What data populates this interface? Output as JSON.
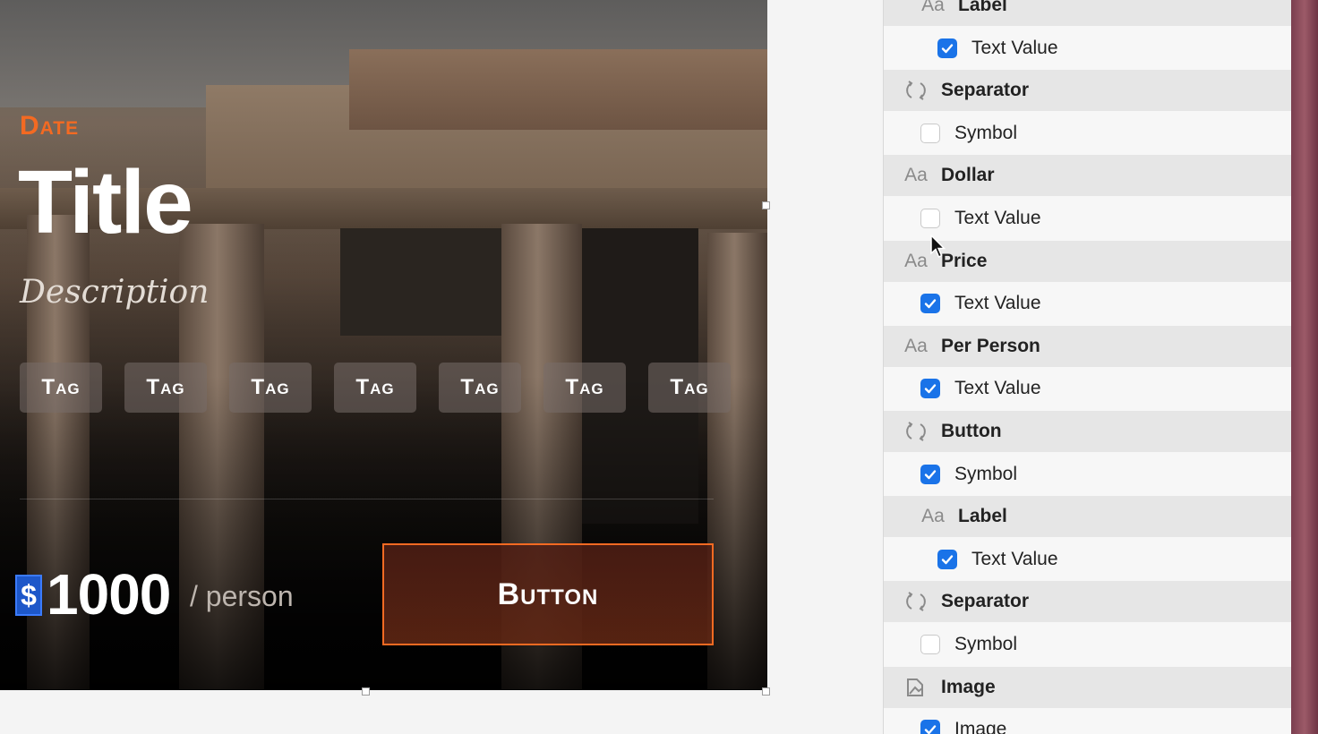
{
  "card": {
    "date": "Date",
    "title": "Title",
    "description": "Description",
    "tags": [
      "Tag",
      "Tag",
      "Tag",
      "Tag",
      "Tag",
      "Tag",
      "Tag"
    ],
    "currency_symbol": "$",
    "price": "1000",
    "per_person": "/ person",
    "button_label": "Button",
    "accent_color": "#f36a22"
  },
  "inspector": {
    "rows": [
      {
        "kind": "header",
        "icon": "text-icon",
        "label": "Label",
        "indent": 1
      },
      {
        "kind": "item",
        "checked": true,
        "label": "Text Value",
        "indent": 2
      },
      {
        "kind": "header",
        "icon": "symbol-icon",
        "label": "Separator",
        "indent": 0
      },
      {
        "kind": "item",
        "checked": false,
        "label": "Symbol",
        "indent": 1
      },
      {
        "kind": "header",
        "icon": "text-icon",
        "label": "Dollar",
        "indent": 0
      },
      {
        "kind": "item",
        "checked": false,
        "label": "Text Value",
        "indent": 1
      },
      {
        "kind": "header",
        "icon": "text-icon",
        "label": "Price",
        "indent": 0
      },
      {
        "kind": "item",
        "checked": true,
        "label": "Text Value",
        "indent": 1
      },
      {
        "kind": "header",
        "icon": "text-icon",
        "label": "Per Person",
        "indent": 0
      },
      {
        "kind": "item",
        "checked": true,
        "label": "Text Value",
        "indent": 1
      },
      {
        "kind": "header",
        "icon": "symbol-icon",
        "label": "Button",
        "indent": 0
      },
      {
        "kind": "item",
        "checked": true,
        "label": "Symbol",
        "indent": 1
      },
      {
        "kind": "header",
        "icon": "text-icon",
        "label": "Label",
        "indent": 1
      },
      {
        "kind": "item",
        "checked": true,
        "label": "Text Value",
        "indent": 2
      },
      {
        "kind": "header",
        "icon": "symbol-icon",
        "label": "Separator",
        "indent": 0
      },
      {
        "kind": "item",
        "checked": false,
        "label": "Symbol",
        "indent": 1
      },
      {
        "kind": "header",
        "icon": "image-icon",
        "label": "Image",
        "indent": 0
      },
      {
        "kind": "item",
        "checked": true,
        "label": "Image",
        "indent": 1
      }
    ],
    "text_icon_glyph": "Aa",
    "check_color": "#1a73e8"
  }
}
